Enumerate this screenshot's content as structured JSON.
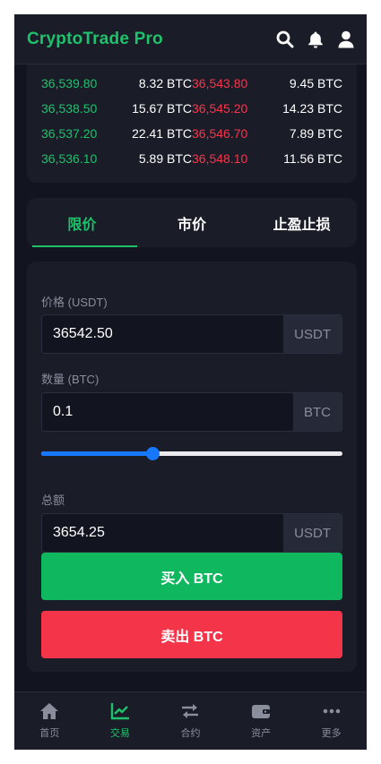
{
  "header": {
    "title": "CryptoTrade Pro",
    "icons": [
      "search-icon",
      "bell-icon",
      "user-icon"
    ]
  },
  "orderbook": {
    "rows": [
      {
        "bid_price": "36,539.80",
        "bid_amount": "8.32 BTC",
        "ask_price": "36,543.80",
        "ask_amount": "9.45 BTC"
      },
      {
        "bid_price": "36,538.50",
        "bid_amount": "15.67 BTC",
        "ask_price": "36,545.20",
        "ask_amount": "14.23 BTC"
      },
      {
        "bid_price": "36,537.20",
        "bid_amount": "22.41 BTC",
        "ask_price": "36,546.70",
        "ask_amount": "7.89 BTC"
      },
      {
        "bid_price": "36,536.10",
        "bid_amount": "5.89 BTC",
        "ask_price": "36,548.10",
        "ask_amount": "11.56 BTC"
      }
    ]
  },
  "tabs": [
    {
      "label": "限价",
      "active": true
    },
    {
      "label": "市价",
      "active": false
    },
    {
      "label": "止盈止损",
      "active": false
    }
  ],
  "form": {
    "price_label": "价格 (USDT)",
    "price_value": "36542.50",
    "price_unit": "USDT",
    "amount_label": "数量 (BTC)",
    "amount_value": "0.1",
    "amount_unit": "BTC",
    "slider_percent": 37,
    "total_label": "总额",
    "total_value": "3654.25",
    "total_unit": "USDT",
    "buy_label": "买入 BTC",
    "sell_label": "卖出 BTC"
  },
  "bottom_nav": [
    {
      "label": "首页",
      "icon": "home-icon",
      "active": false
    },
    {
      "label": "交易",
      "icon": "chart-icon",
      "active": true
    },
    {
      "label": "合约",
      "icon": "swap-icon",
      "active": false
    },
    {
      "label": "资产",
      "icon": "wallet-icon",
      "active": false
    },
    {
      "label": "更多",
      "icon": "more-icon",
      "active": false
    }
  ],
  "colors": {
    "background": "#121420",
    "panel": "#1a1c28",
    "green": "#1fc16b",
    "red": "#f6364b",
    "buy_button": "#0fb85f",
    "sell_button": "#f43449",
    "slider": "#1677ff"
  }
}
